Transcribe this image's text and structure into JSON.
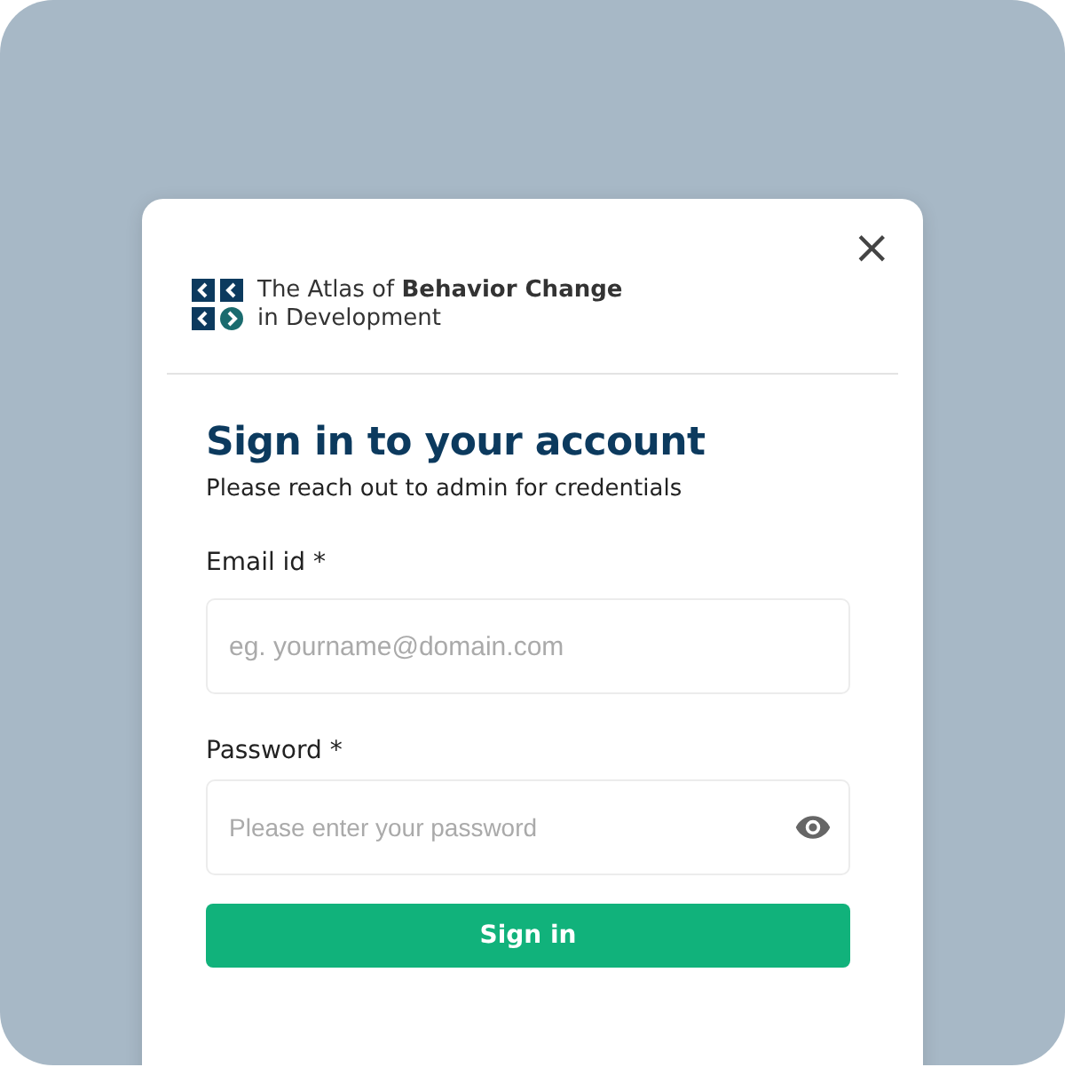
{
  "logo": {
    "line1": "The Atlas of **Behavior Change**",
    "line2": "in Development"
  },
  "close_button": {
    "label": "×"
  },
  "title": "Sign in to your account",
  "subtitle": "Please reach out to admin for credentials",
  "fields": [
    {
      "kind": "email",
      "label": "Email id *",
      "placeholder": "eg. yourname@domain.com"
    },
    {
      "kind": "password",
      "label": "Password *",
      "placeholder": "Please enter your password"
    }
  ],
  "submit_button": {
    "label": "Sign in"
  }
}
